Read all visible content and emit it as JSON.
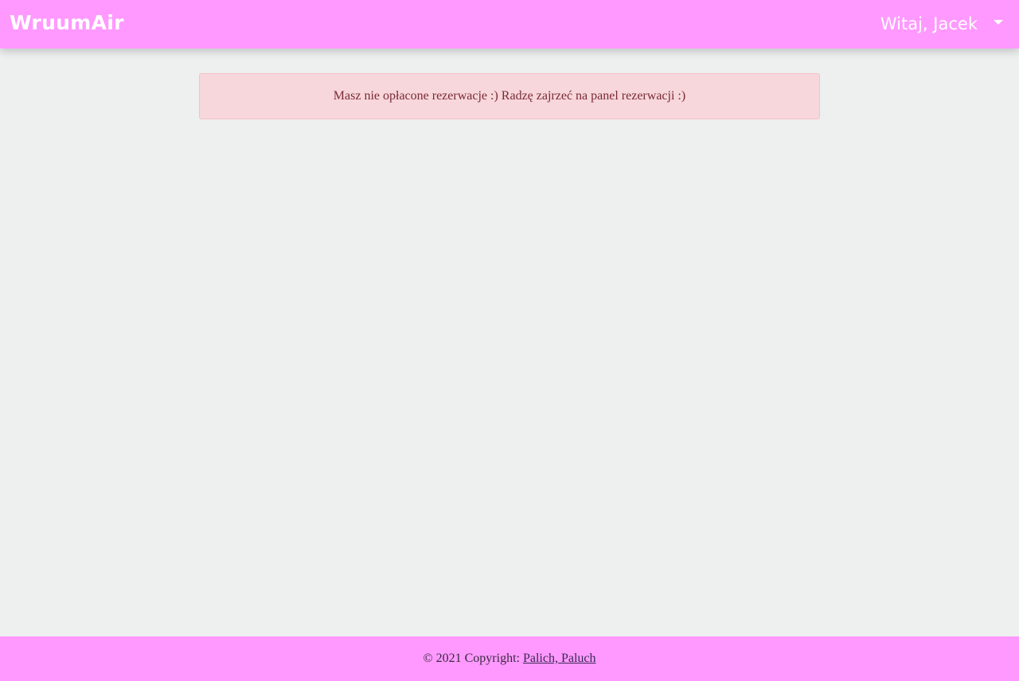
{
  "navbar": {
    "brand": "WruumAir",
    "greeting": "Witaj, Jacek",
    "dropdown_icon": "caret-down-icon",
    "background_color": "#ff99ff",
    "text_color": "#ffffff"
  },
  "alert": {
    "message": "Masz nie opłacone rezerwacje :) Radzę zajrzeć na panel rezerwacji :)",
    "background_color": "#f7d7db",
    "text_color": "#7a2a36"
  },
  "footer": {
    "copyright": "© 2021 Copyright: ",
    "link_text": "Palich, Paluch",
    "background_color": "#ff99ff"
  },
  "page": {
    "background_color": "#edf0ef"
  }
}
